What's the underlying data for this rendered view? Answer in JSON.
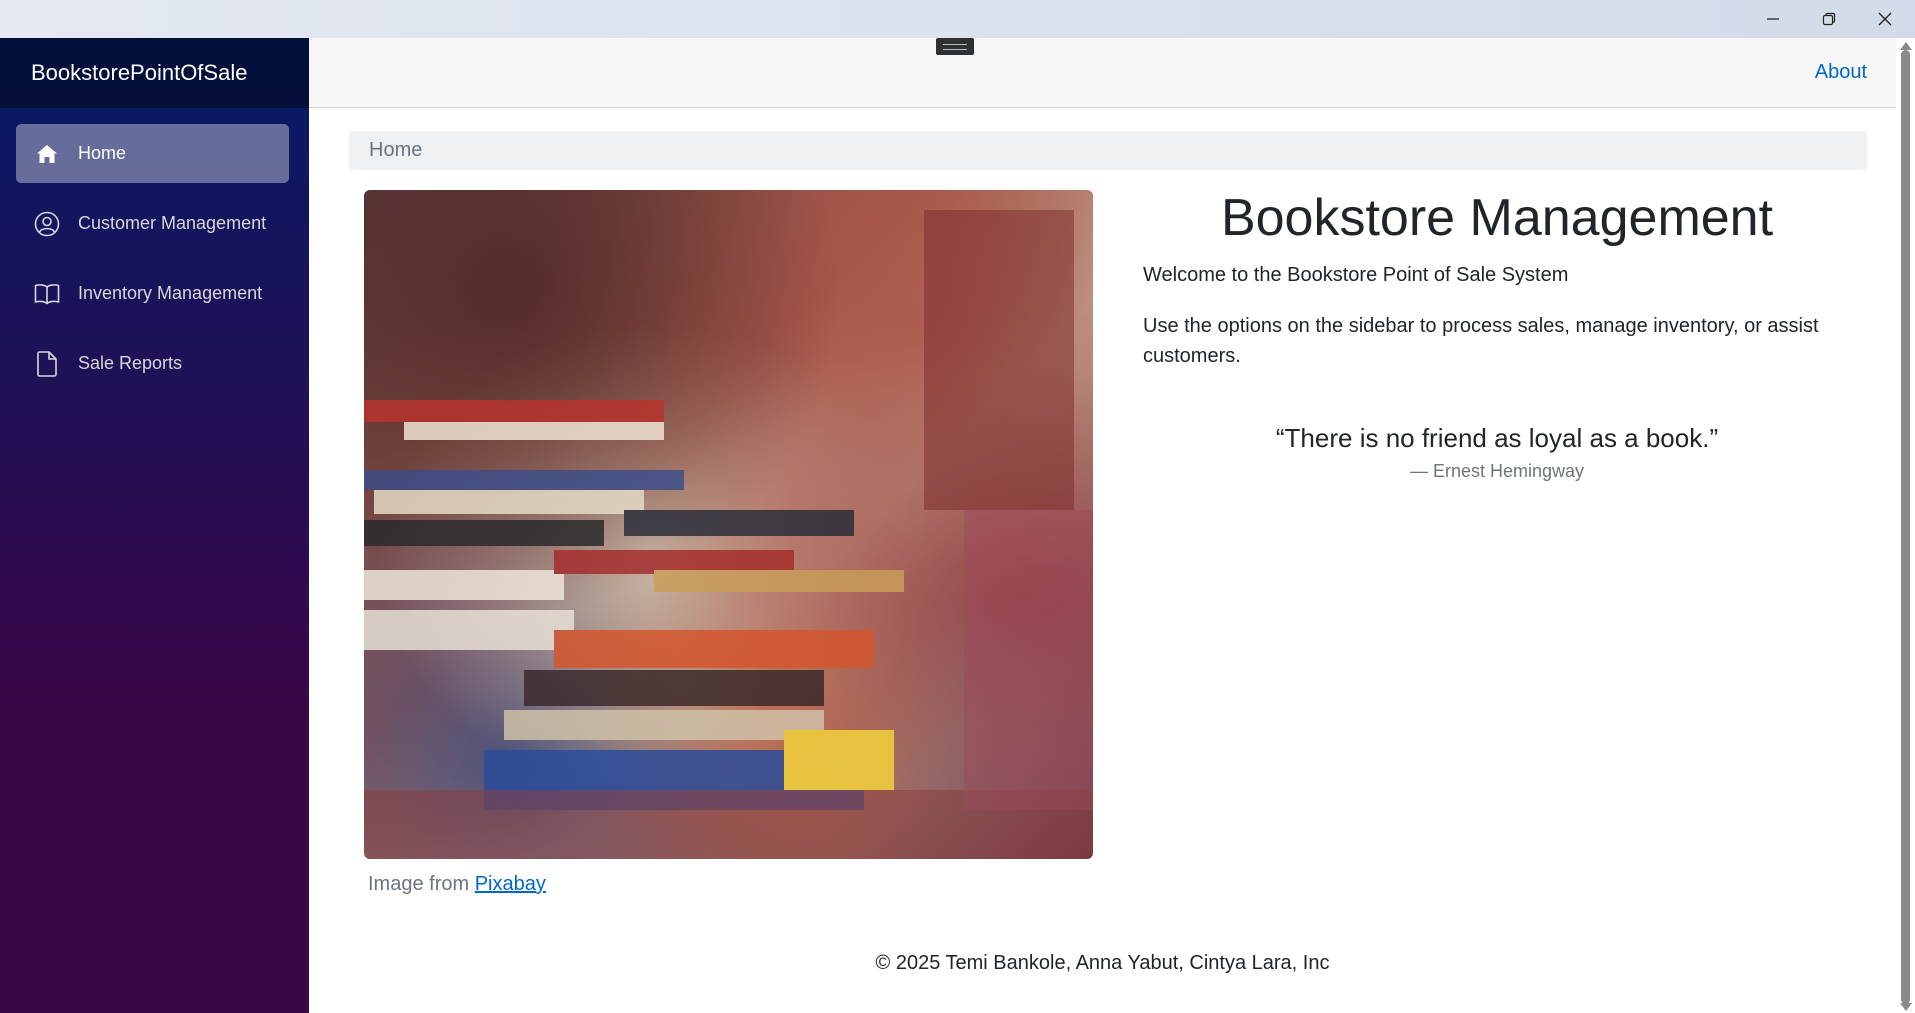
{
  "window": {
    "controls": {
      "minimize_icon": "minimize-icon",
      "restore_icon": "restore-icon",
      "close_icon": "close-icon"
    }
  },
  "sidebar": {
    "brand": "BookstorePointOfSale",
    "items": [
      {
        "label": "Home",
        "icon": "home-icon",
        "active": true
      },
      {
        "label": "Customer Management",
        "icon": "user-circle-icon",
        "active": false
      },
      {
        "label": "Inventory Management",
        "icon": "book-open-icon",
        "active": false
      },
      {
        "label": "Sale Reports",
        "icon": "document-icon",
        "active": false
      }
    ]
  },
  "header": {
    "about_label": "About"
  },
  "main": {
    "breadcrumb": "Home",
    "image_caption_prefix": "Image from",
    "image_caption_link": "Pixabay",
    "title": "Bookstore Management",
    "welcome": "Welcome to the Bookstore Point of Sale System",
    "instructions": "Use the options on the sidebar to process sales, manage inventory, or assist customers.",
    "quote": "“There is no friend as loyal as a book.”",
    "quote_author": "— Ernest Hemingway"
  },
  "footer": {
    "text": "© 2025 Temi Bankole, Anna Yabut, Cintya Lara, Inc"
  },
  "colors": {
    "sidebar_top": "#051b66",
    "sidebar_bottom": "#3a0647",
    "link": "#0066cc",
    "breadcrumb_bg": "#eef0f2"
  }
}
